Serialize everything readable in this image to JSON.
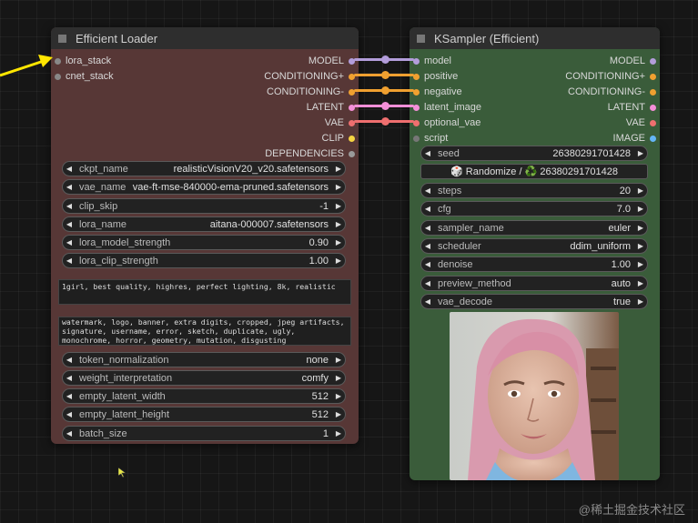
{
  "loader": {
    "title": "Efficient Loader",
    "inputs": [
      "lora_stack",
      "cnet_stack"
    ],
    "outputs": [
      "MODEL",
      "CONDITIONING+",
      "CONDITIONING-",
      "LATENT",
      "VAE",
      "CLIP",
      "DEPENDENCIES"
    ],
    "widgets": [
      {
        "label": "ckpt_name",
        "value": "realisticVisionV20_v20.safetensors"
      },
      {
        "label": "vae_name",
        "value": "vae-ft-mse-840000-ema-pruned.safetensors"
      },
      {
        "label": "clip_skip",
        "value": "-1"
      },
      {
        "label": "lora_name",
        "value": "aitana-000007.safetensors"
      },
      {
        "label": "lora_model_strength",
        "value": "0.90"
      },
      {
        "label": "lora_clip_strength",
        "value": "1.00"
      }
    ],
    "positive_prompt": "1girl, best quality, highres, perfect lighting, 8k, realistic",
    "negative_prompt": "watermark, logo, banner, extra digits, cropped, jpeg artifacts, signature, username, error, sketch, duplicate, ugly, monochrome, horror, geometry, mutation, disgusting",
    "widgets2": [
      {
        "label": "token_normalization",
        "value": "none"
      },
      {
        "label": "weight_interpretation",
        "value": "comfy"
      },
      {
        "label": "empty_latent_width",
        "value": "512"
      },
      {
        "label": "empty_latent_height",
        "value": "512"
      },
      {
        "label": "batch_size",
        "value": "1"
      }
    ]
  },
  "ksampler": {
    "title": "KSampler (Efficient)",
    "inputs": [
      "model",
      "positive",
      "negative",
      "latent_image",
      "optional_vae",
      "script"
    ],
    "outputs": [
      "MODEL",
      "CONDITIONING+",
      "CONDITIONING-",
      "LATENT",
      "VAE",
      "IMAGE"
    ],
    "seed": {
      "label": "seed",
      "value": "26380291701428"
    },
    "randomize_label": "🎲 Randomize / ♻️ 26380291701428",
    "widgets": [
      {
        "label": "steps",
        "value": "20"
      },
      {
        "label": "cfg",
        "value": "7.0"
      },
      {
        "label": "sampler_name",
        "value": "euler"
      },
      {
        "label": "scheduler",
        "value": "ddim_uniform"
      },
      {
        "label": "denoise",
        "value": "1.00"
      },
      {
        "label": "preview_method",
        "value": "auto"
      },
      {
        "label": "vae_decode",
        "value": "true"
      }
    ]
  },
  "colors": {
    "model": "#b39ddb",
    "conditioning": "#f0a030",
    "latent": "#f48fd8",
    "vae": "#ef6f6f",
    "clip": "#f5d442",
    "dependencies": "#9a9a9a",
    "image": "#64b5f6",
    "script": "#777777",
    "arrow": "#ffe600"
  },
  "watermark": "@稀土掘金技术社区"
}
